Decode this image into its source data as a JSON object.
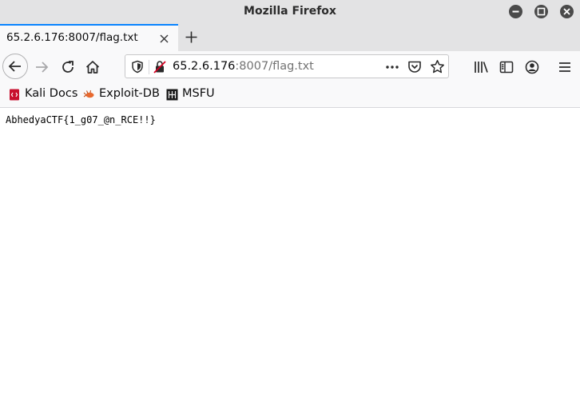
{
  "window": {
    "title": "Mozilla Firefox",
    "controls": [
      "minimize",
      "maximize",
      "close"
    ]
  },
  "tabs": [
    {
      "title": "65.2.6.176:8007/flag.txt",
      "active": true,
      "close_icon": "close-icon"
    }
  ],
  "new_tab_icon": "plus-icon",
  "navbar": {
    "back_icon": "arrow-left-icon",
    "forward_icon": "arrow-right-icon",
    "reload_icon": "reload-icon",
    "home_icon": "home-icon",
    "url_host": "65.2.6.176",
    "url_path": ":8007/flag.txt",
    "page_actions_icon": "ellipsis-icon",
    "pocket_icon": "pocket-icon",
    "bookmark_icon": "star-icon",
    "library_icon": "library-icon",
    "sidebar_icon": "sidebar-icon",
    "account_icon": "account-icon",
    "menu_icon": "hamburger-menu-icon"
  },
  "bookmarks": [
    {
      "label": "Kali Docs",
      "icon": "kali-docs-icon"
    },
    {
      "label": "Exploit-DB",
      "icon": "exploit-db-icon"
    },
    {
      "label": "MSFU",
      "icon": "msfu-icon"
    }
  ],
  "content": {
    "text": "AbhedyaCTF{1_g07_@n_RCE!!}"
  },
  "colors": {
    "chrome": "#e3e3e4",
    "toolbar": "#f9f9fa",
    "active_tab_accent": "#0a84ff"
  }
}
